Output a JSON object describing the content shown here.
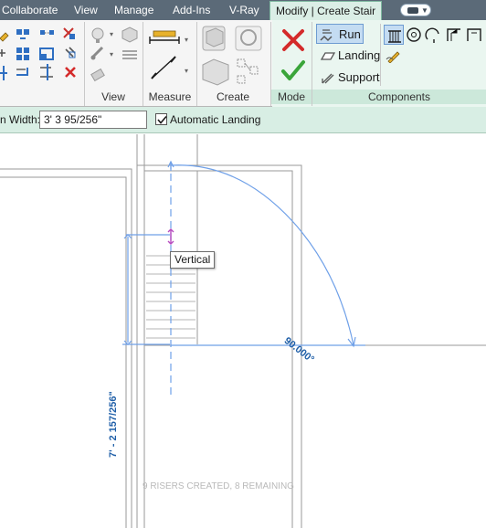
{
  "tabs": [
    {
      "label": "Collaborate",
      "active": false
    },
    {
      "label": "View",
      "active": false
    },
    {
      "label": "Manage",
      "active": false
    },
    {
      "label": "Add-Ins",
      "active": false
    },
    {
      "label": "V-Ray",
      "active": false
    },
    {
      "label": "Modify | Create Stair",
      "active": true
    }
  ],
  "panels": {
    "view": "View",
    "measure": "Measure",
    "create": "Create",
    "mode": "Mode",
    "components": "Components"
  },
  "components": {
    "run": "Run",
    "landing": "Landing",
    "support": "Support"
  },
  "options_bar": {
    "width_label": "n Width:",
    "width_value": "3'  3 95/256\"",
    "automatic_landing_label": "Automatic Landing",
    "automatic_landing_checked": true
  },
  "canvas": {
    "tooltip": "Vertical",
    "angle_dimension": "90.000°",
    "length_dimension": "7' - 2 157/256\"",
    "riser_status": "9 RISERS CREATED, 8 REMAINING"
  },
  "colors": {
    "tab_bar": "#5b6a78",
    "context_tab": "#dbeee6",
    "options_bar": "#d8eee4",
    "dimension_blue": "#1f5fa8",
    "sketch_blue": "#6fa0e8",
    "cancel_red": "#d42a2a",
    "finish_green": "#3aa53a"
  }
}
